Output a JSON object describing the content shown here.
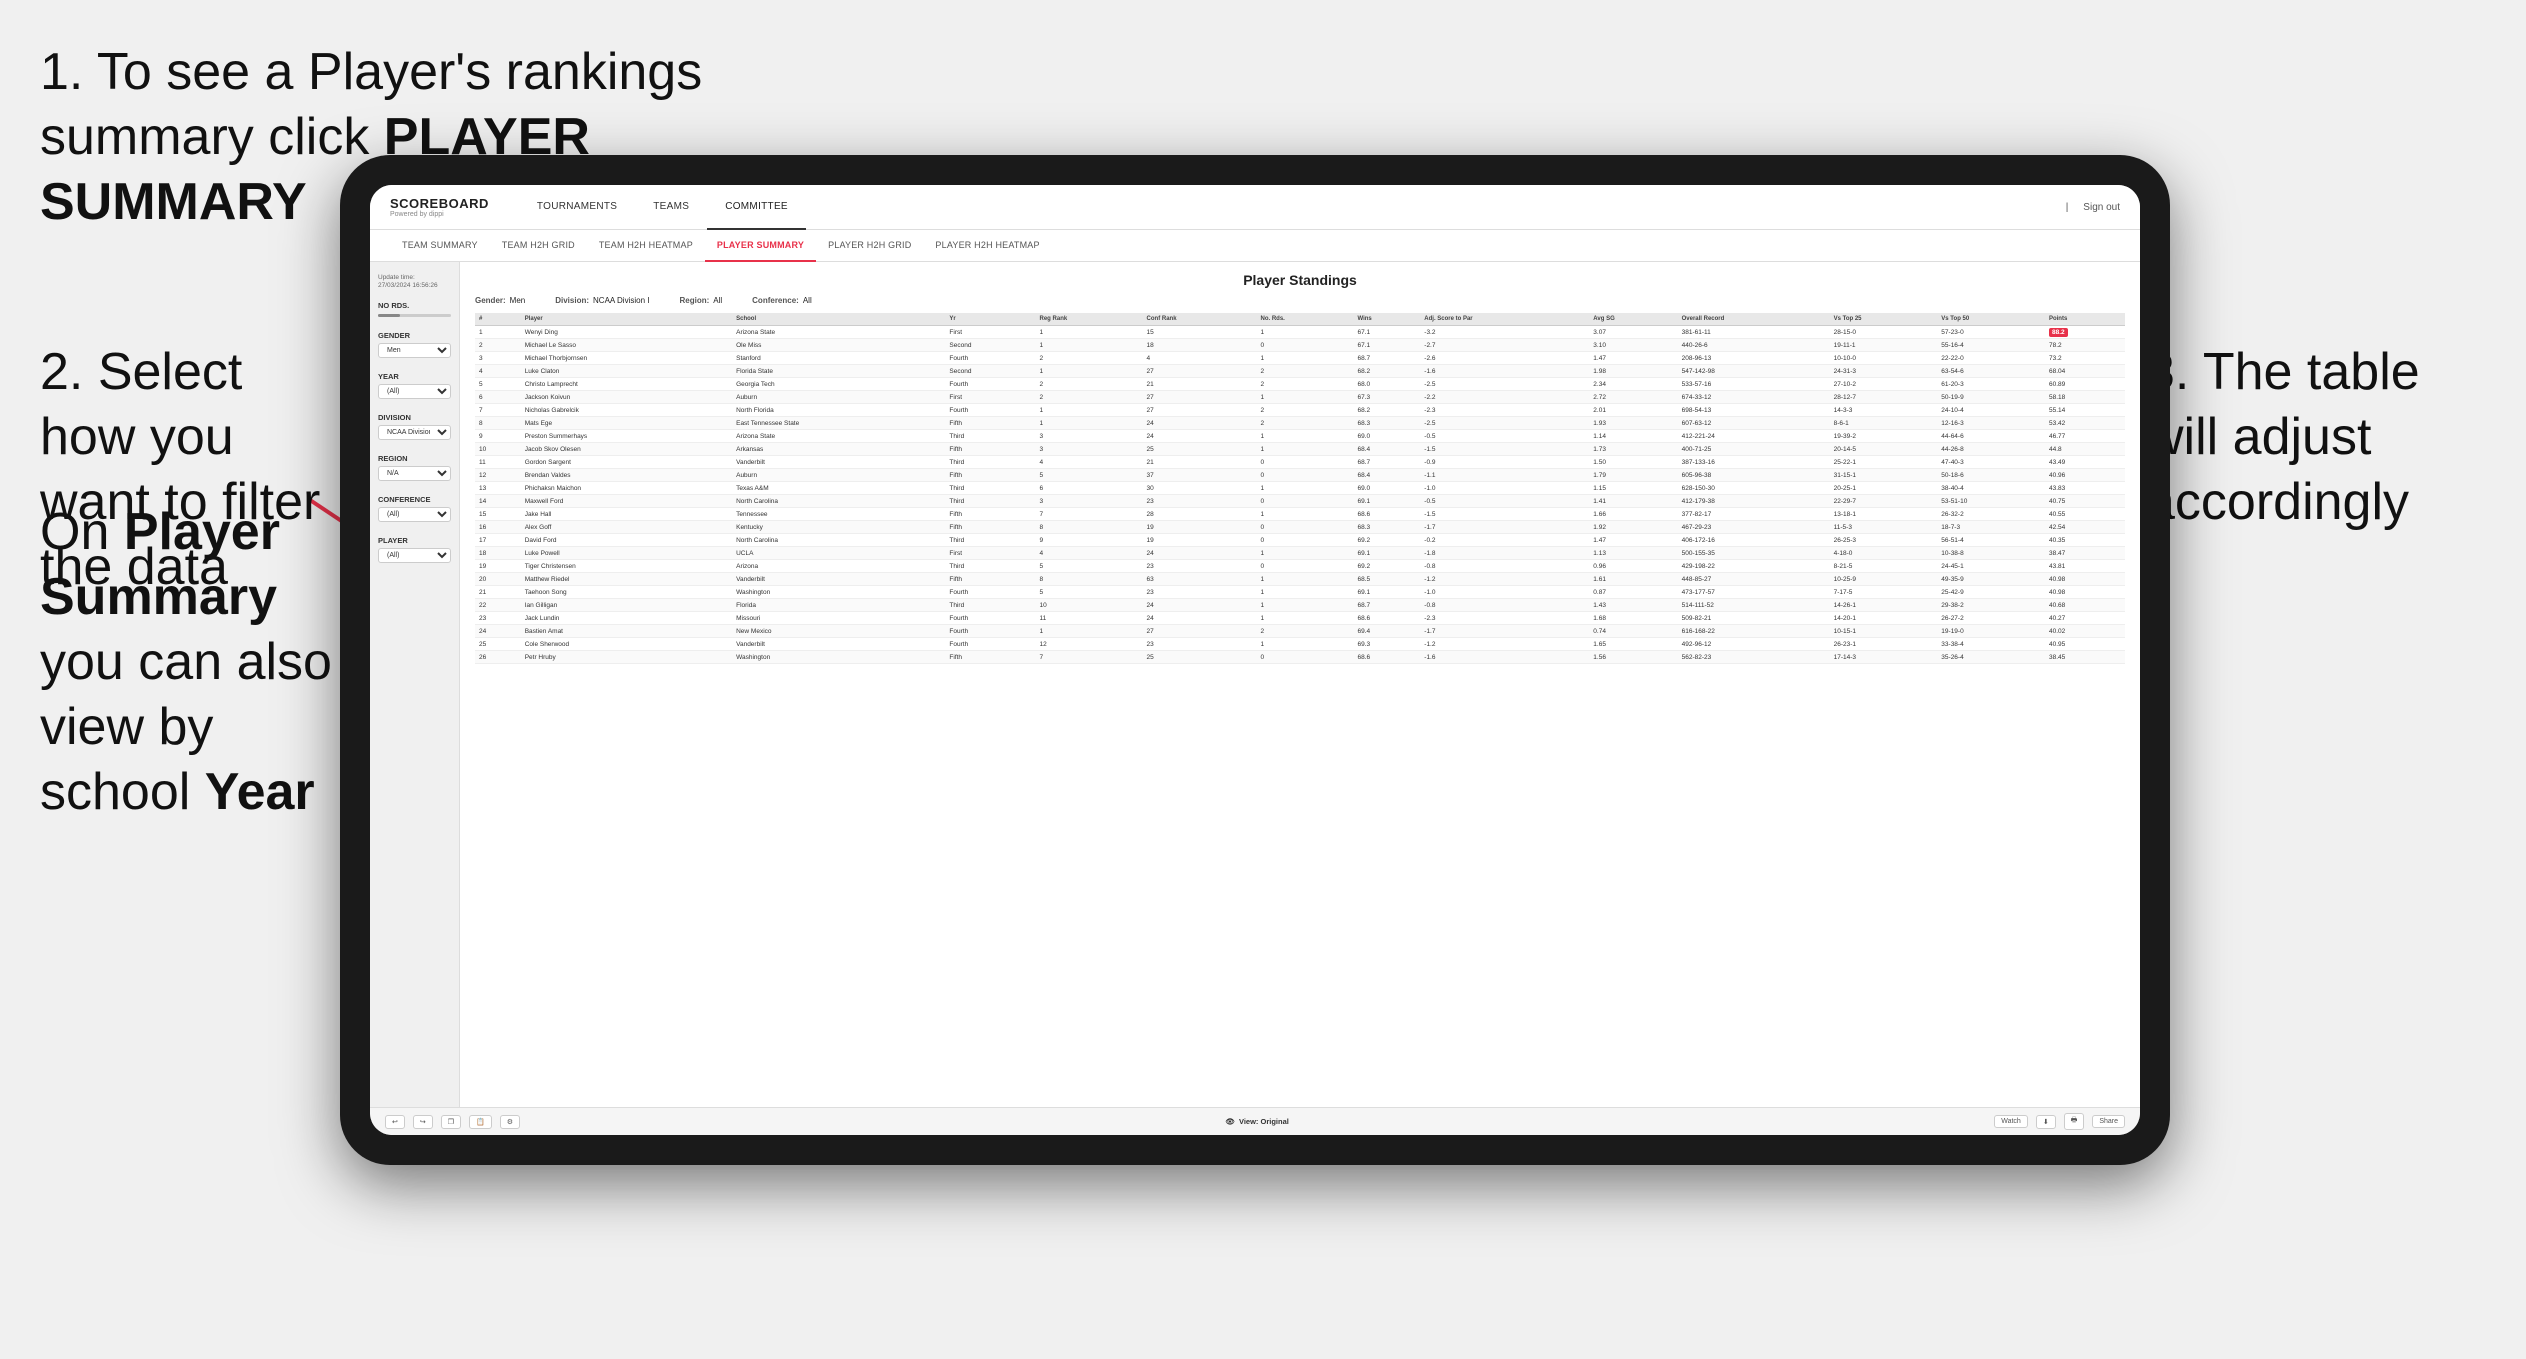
{
  "instructions": {
    "step1": {
      "number": "1.",
      "text": "To see a Player's rankings summary click ",
      "bold": "PLAYER SUMMARY"
    },
    "step2": {
      "number": "2.",
      "text": "Select how you want to filter the data"
    },
    "step3": {
      "text": "3. The table will adjust accordingly"
    },
    "bottom": {
      "intro": "On ",
      "bold1": "Player Summary",
      "mid": " you can also view by school ",
      "bold2": "Year"
    }
  },
  "app": {
    "logo": "SCOREBOARD",
    "logo_sub": "Powered by dippi",
    "sign_out": "Sign out",
    "nav": [
      {
        "label": "TOURNAMENTS",
        "active": false
      },
      {
        "label": "TEAMS",
        "active": false
      },
      {
        "label": "COMMITTEE",
        "active": true
      }
    ],
    "sub_nav": [
      {
        "label": "TEAM SUMMARY",
        "active": false
      },
      {
        "label": "TEAM H2H GRID",
        "active": false
      },
      {
        "label": "TEAM H2H HEATMAP",
        "active": false
      },
      {
        "label": "PLAYER SUMMARY",
        "active": true
      },
      {
        "label": "PLAYER H2H GRID",
        "active": false
      },
      {
        "label": "PLAYER H2H HEATMAP",
        "active": false
      }
    ]
  },
  "sidebar": {
    "update_label": "Update time:",
    "update_value": "27/03/2024 16:56:26",
    "no_rds_label": "No Rds.",
    "gender_label": "Gender",
    "gender_value": "Men",
    "year_label": "Year",
    "year_value": "(All)",
    "division_label": "Division",
    "division_value": "NCAA Division I",
    "region_label": "Region",
    "region_value": "N/A",
    "conference_label": "Conference",
    "conference_value": "(All)",
    "player_label": "Player",
    "player_value": "(All)"
  },
  "table": {
    "title": "Player Standings",
    "filters": {
      "gender_label": "Gender:",
      "gender_value": "Men",
      "division_label": "Division:",
      "division_value": "NCAA Division I",
      "region_label": "Region:",
      "region_value": "All",
      "conference_label": "Conference:",
      "conference_value": "All"
    },
    "columns": [
      "#",
      "Player",
      "School",
      "Yr",
      "Reg Rank",
      "Conf Rank",
      "No. Rds.",
      "Wins",
      "Adj. Score to Par",
      "Avg SG",
      "Overall Record",
      "Vs Top 25",
      "Vs Top 50",
      "Points"
    ],
    "rows": [
      {
        "rank": "1",
        "player": "Wenyi Ding",
        "school": "Arizona State",
        "yr": "First",
        "reg_rank": "1",
        "conf_rank": "15",
        "no_rds": "1",
        "wins": "67.1",
        "adj": "-3.2",
        "avg_sg": "3.07",
        "record": "381-61-11",
        "vs25": "28-15-0",
        "vs50": "57-23-0",
        "points": "88.2",
        "highlight": true
      },
      {
        "rank": "2",
        "player": "Michael Le Sasso",
        "school": "Ole Miss",
        "yr": "Second",
        "reg_rank": "1",
        "conf_rank": "18",
        "no_rds": "0",
        "wins": "67.1",
        "adj": "-2.7",
        "avg_sg": "3.10",
        "record": "440-26-6",
        "vs25": "19-11-1",
        "vs50": "55-16-4",
        "points": "78.2",
        "highlight": false
      },
      {
        "rank": "3",
        "player": "Michael Thorbjornsen",
        "school": "Stanford",
        "yr": "Fourth",
        "reg_rank": "2",
        "conf_rank": "4",
        "no_rds": "1",
        "wins": "68.7",
        "adj": "-2.6",
        "avg_sg": "1.47",
        "record": "208-96-13",
        "vs25": "10-10-0",
        "vs50": "22-22-0",
        "points": "73.2",
        "highlight": false
      },
      {
        "rank": "4",
        "player": "Luke Claton",
        "school": "Florida State",
        "yr": "Second",
        "reg_rank": "1",
        "conf_rank": "27",
        "no_rds": "2",
        "wins": "68.2",
        "adj": "-1.6",
        "avg_sg": "1.98",
        "record": "547-142-98",
        "vs25": "24-31-3",
        "vs50": "63-54-6",
        "points": "68.04",
        "highlight": false
      },
      {
        "rank": "5",
        "player": "Christo Lamprecht",
        "school": "Georgia Tech",
        "yr": "Fourth",
        "reg_rank": "2",
        "conf_rank": "21",
        "no_rds": "2",
        "wins": "68.0",
        "adj": "-2.5",
        "avg_sg": "2.34",
        "record": "533-57-16",
        "vs25": "27-10-2",
        "vs50": "61-20-3",
        "points": "60.89",
        "highlight": false
      },
      {
        "rank": "6",
        "player": "Jackson Koivun",
        "school": "Auburn",
        "yr": "First",
        "reg_rank": "2",
        "conf_rank": "27",
        "no_rds": "1",
        "wins": "67.3",
        "adj": "-2.2",
        "avg_sg": "2.72",
        "record": "674-33-12",
        "vs25": "28-12-7",
        "vs50": "50-19-9",
        "points": "58.18",
        "highlight": false
      },
      {
        "rank": "7",
        "player": "Nicholas Gabrelcik",
        "school": "North Florida",
        "yr": "Fourth",
        "reg_rank": "1",
        "conf_rank": "27",
        "no_rds": "2",
        "wins": "68.2",
        "adj": "-2.3",
        "avg_sg": "2.01",
        "record": "698-54-13",
        "vs25": "14-3-3",
        "vs50": "24-10-4",
        "points": "55.14",
        "highlight": false
      },
      {
        "rank": "8",
        "player": "Mats Ege",
        "school": "East Tennessee State",
        "yr": "Fifth",
        "reg_rank": "1",
        "conf_rank": "24",
        "no_rds": "2",
        "wins": "68.3",
        "adj": "-2.5",
        "avg_sg": "1.93",
        "record": "607-63-12",
        "vs25": "8-6-1",
        "vs50": "12-16-3",
        "points": "53.42",
        "highlight": false
      },
      {
        "rank": "9",
        "player": "Preston Summerhays",
        "school": "Arizona State",
        "yr": "Third",
        "reg_rank": "3",
        "conf_rank": "24",
        "no_rds": "1",
        "wins": "69.0",
        "adj": "-0.5",
        "avg_sg": "1.14",
        "record": "412-221-24",
        "vs25": "19-39-2",
        "vs50": "44-64-6",
        "points": "46.77",
        "highlight": false
      },
      {
        "rank": "10",
        "player": "Jacob Skov Olesen",
        "school": "Arkansas",
        "yr": "Fifth",
        "reg_rank": "3",
        "conf_rank": "25",
        "no_rds": "1",
        "wins": "68.4",
        "adj": "-1.5",
        "avg_sg": "1.73",
        "record": "400-71-25",
        "vs25": "20-14-5",
        "vs50": "44-26-8",
        "points": "44.8",
        "highlight": false
      },
      {
        "rank": "11",
        "player": "Gordon Sargent",
        "school": "Vanderbilt",
        "yr": "Third",
        "reg_rank": "4",
        "conf_rank": "21",
        "no_rds": "0",
        "wins": "68.7",
        "adj": "-0.9",
        "avg_sg": "1.50",
        "record": "387-133-16",
        "vs25": "25-22-1",
        "vs50": "47-40-3",
        "points": "43.49",
        "highlight": false
      },
      {
        "rank": "12",
        "player": "Brendan Valdes",
        "school": "Auburn",
        "yr": "Fifth",
        "reg_rank": "5",
        "conf_rank": "37",
        "no_rds": "0",
        "wins": "68.4",
        "adj": "-1.1",
        "avg_sg": "1.79",
        "record": "605-96-38",
        "vs25": "31-15-1",
        "vs50": "50-18-6",
        "points": "40.96",
        "highlight": false
      },
      {
        "rank": "13",
        "player": "Phichaksn Maichon",
        "school": "Texas A&M",
        "yr": "Third",
        "reg_rank": "6",
        "conf_rank": "30",
        "no_rds": "1",
        "wins": "69.0",
        "adj": "-1.0",
        "avg_sg": "1.15",
        "record": "628-150-30",
        "vs25": "20-25-1",
        "vs50": "38-40-4",
        "points": "43.83",
        "highlight": false
      },
      {
        "rank": "14",
        "player": "Maxwell Ford",
        "school": "North Carolina",
        "yr": "Third",
        "reg_rank": "3",
        "conf_rank": "23",
        "no_rds": "0",
        "wins": "69.1",
        "adj": "-0.5",
        "avg_sg": "1.41",
        "record": "412-179-38",
        "vs25": "22-29-7",
        "vs50": "53-51-10",
        "points": "40.75",
        "highlight": false
      },
      {
        "rank": "15",
        "player": "Jake Hall",
        "school": "Tennessee",
        "yr": "Fifth",
        "reg_rank": "7",
        "conf_rank": "28",
        "no_rds": "1",
        "wins": "68.6",
        "adj": "-1.5",
        "avg_sg": "1.66",
        "record": "377-82-17",
        "vs25": "13-18-1",
        "vs50": "26-32-2",
        "points": "40.55",
        "highlight": false
      },
      {
        "rank": "16",
        "player": "Alex Goff",
        "school": "Kentucky",
        "yr": "Fifth",
        "reg_rank": "8",
        "conf_rank": "19",
        "no_rds": "0",
        "wins": "68.3",
        "adj": "-1.7",
        "avg_sg": "1.92",
        "record": "467-29-23",
        "vs25": "11-5-3",
        "vs50": "18-7-3",
        "points": "42.54",
        "highlight": false
      },
      {
        "rank": "17",
        "player": "David Ford",
        "school": "North Carolina",
        "yr": "Third",
        "reg_rank": "9",
        "conf_rank": "19",
        "no_rds": "0",
        "wins": "69.2",
        "adj": "-0.2",
        "avg_sg": "1.47",
        "record": "406-172-16",
        "vs25": "26-25-3",
        "vs50": "56-51-4",
        "points": "40.35",
        "highlight": false
      },
      {
        "rank": "18",
        "player": "Luke Powell",
        "school": "UCLA",
        "yr": "First",
        "reg_rank": "4",
        "conf_rank": "24",
        "no_rds": "1",
        "wins": "69.1",
        "adj": "-1.8",
        "avg_sg": "1.13",
        "record": "500-155-35",
        "vs25": "4-18-0",
        "vs50": "10-38-8",
        "points": "38.47",
        "highlight": false
      },
      {
        "rank": "19",
        "player": "Tiger Christensen",
        "school": "Arizona",
        "yr": "Third",
        "reg_rank": "5",
        "conf_rank": "23",
        "no_rds": "0",
        "wins": "69.2",
        "adj": "-0.8",
        "avg_sg": "0.96",
        "record": "429-198-22",
        "vs25": "8-21-5",
        "vs50": "24-45-1",
        "points": "43.81",
        "highlight": false
      },
      {
        "rank": "20",
        "player": "Matthew Riedel",
        "school": "Vanderbilt",
        "yr": "Fifth",
        "reg_rank": "8",
        "conf_rank": "63",
        "no_rds": "1",
        "wins": "68.5",
        "adj": "-1.2",
        "avg_sg": "1.61",
        "record": "448-85-27",
        "vs25": "10-25-9",
        "vs50": "49-35-9",
        "points": "40.98",
        "highlight": false
      },
      {
        "rank": "21",
        "player": "Taehoon Song",
        "school": "Washington",
        "yr": "Fourth",
        "reg_rank": "5",
        "conf_rank": "23",
        "no_rds": "1",
        "wins": "69.1",
        "adj": "-1.0",
        "avg_sg": "0.87",
        "record": "473-177-57",
        "vs25": "7-17-5",
        "vs50": "25-42-9",
        "points": "40.98",
        "highlight": false
      },
      {
        "rank": "22",
        "player": "Ian Gilligan",
        "school": "Florida",
        "yr": "Third",
        "reg_rank": "10",
        "conf_rank": "24",
        "no_rds": "1",
        "wins": "68.7",
        "adj": "-0.8",
        "avg_sg": "1.43",
        "record": "514-111-52",
        "vs25": "14-26-1",
        "vs50": "29-38-2",
        "points": "40.68",
        "highlight": false
      },
      {
        "rank": "23",
        "player": "Jack Lundin",
        "school": "Missouri",
        "yr": "Fourth",
        "reg_rank": "11",
        "conf_rank": "24",
        "no_rds": "1",
        "wins": "68.6",
        "adj": "-2.3",
        "avg_sg": "1.68",
        "record": "509-82-21",
        "vs25": "14-20-1",
        "vs50": "26-27-2",
        "points": "40.27",
        "highlight": false
      },
      {
        "rank": "24",
        "player": "Bastien Amat",
        "school": "New Mexico",
        "yr": "Fourth",
        "reg_rank": "1",
        "conf_rank": "27",
        "no_rds": "2",
        "wins": "69.4",
        "adj": "-1.7",
        "avg_sg": "0.74",
        "record": "616-168-22",
        "vs25": "10-15-1",
        "vs50": "19-19-0",
        "points": "40.02",
        "highlight": false
      },
      {
        "rank": "25",
        "player": "Cole Sherwood",
        "school": "Vanderbilt",
        "yr": "Fourth",
        "reg_rank": "12",
        "conf_rank": "23",
        "no_rds": "1",
        "wins": "69.3",
        "adj": "-1.2",
        "avg_sg": "1.65",
        "record": "492-96-12",
        "vs25": "26-23-1",
        "vs50": "33-38-4",
        "points": "40.95",
        "highlight": false
      },
      {
        "rank": "26",
        "player": "Petr Hruby",
        "school": "Washington",
        "yr": "Fifth",
        "reg_rank": "7",
        "conf_rank": "25",
        "no_rds": "0",
        "wins": "68.6",
        "adj": "-1.6",
        "avg_sg": "1.56",
        "record": "562-82-23",
        "vs25": "17-14-3",
        "vs50": "35-26-4",
        "points": "38.45",
        "highlight": false
      }
    ]
  },
  "toolbar": {
    "view_label": "View: Original",
    "watch_label": "Watch",
    "share_label": "Share"
  }
}
